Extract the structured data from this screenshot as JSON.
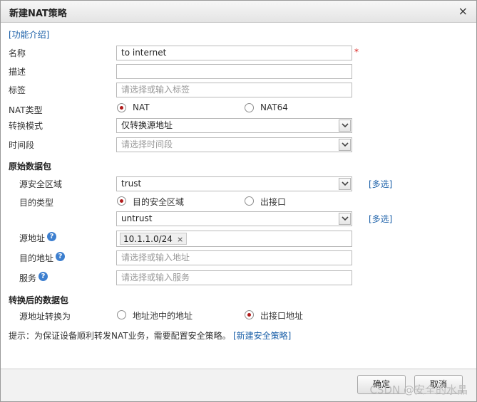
{
  "dialog": {
    "title": "新建NAT策略",
    "close_glyph": "×"
  },
  "intro_link": "[功能介绍]",
  "form": {
    "name": {
      "label": "名称",
      "value": "to internet",
      "required_mark": "*"
    },
    "description": {
      "label": "描述",
      "value": ""
    },
    "tag": {
      "label": "标签",
      "placeholder": "请选择或输入标签"
    },
    "nat_type": {
      "label": "NAT类型",
      "options": [
        "NAT",
        "NAT64"
      ],
      "selected": "NAT"
    },
    "conversion_mode": {
      "label": "转换模式",
      "value": "仅转换源地址"
    },
    "time_range": {
      "label": "时间段",
      "placeholder": "请选择时间段"
    }
  },
  "original_packet": {
    "heading": "原始数据包",
    "source_zone": {
      "label": "源安全区域",
      "value": "trust",
      "multi_link": "[多选]"
    },
    "dest_type": {
      "label": "目的类型",
      "options": [
        "目的安全区域",
        "出接口"
      ],
      "selected": "目的安全区域"
    },
    "dest_zone": {
      "value": "untrust",
      "multi_link": "[多选]"
    },
    "source_address": {
      "label": "源地址",
      "tag": "10.1.1.0/24",
      "tag_remove": "×"
    },
    "dest_address": {
      "label": "目的地址",
      "placeholder": "请选择或输入地址"
    },
    "service": {
      "label": "服务",
      "placeholder": "请选择或输入服务"
    },
    "help_glyph": "?"
  },
  "translated_packet": {
    "heading": "转换后的数据包",
    "source_translate": {
      "label": "源地址转换为",
      "options": [
        "地址池中的地址",
        "出接口地址"
      ],
      "selected": "出接口地址"
    }
  },
  "hint": {
    "text": "提示：为保证设备顺利转发NAT业务，需要配置安全策略。",
    "link": "[新建安全策略]"
  },
  "buttons": {
    "ok": "确定",
    "cancel": "取消"
  },
  "watermark": "CSDN @安全的水晶",
  "colors": {
    "link": "#1a5fa8",
    "required": "#d9231f",
    "radio_dot": "#b01b1b",
    "help_icon": "#3d7fcf"
  }
}
